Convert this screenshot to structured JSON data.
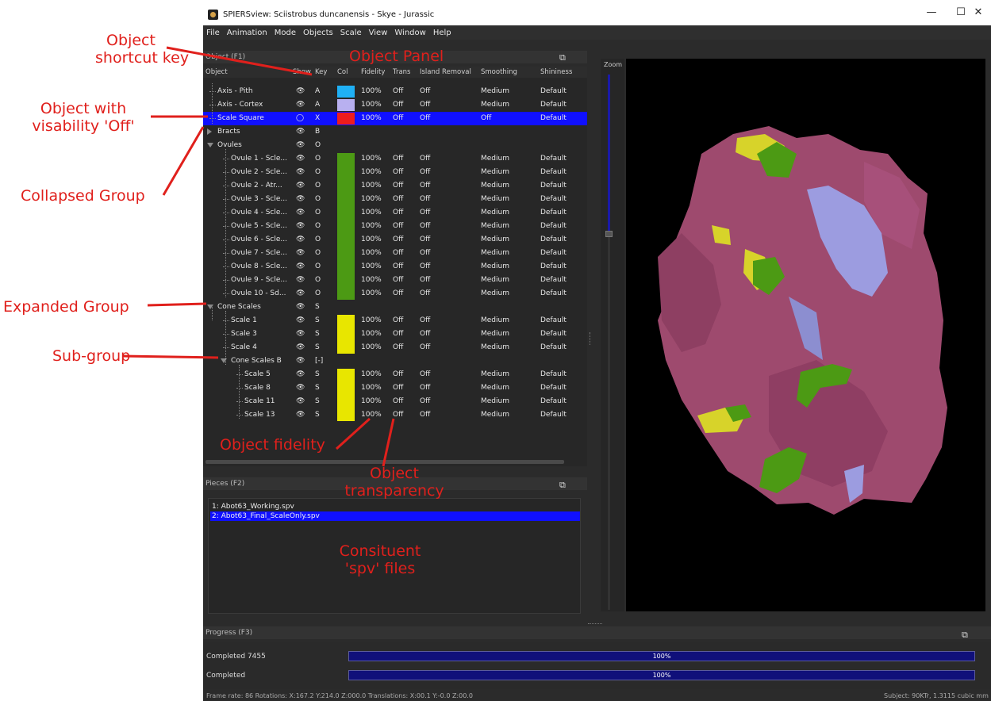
{
  "window": {
    "title": "SPIERSview: Sciistrobus duncanensis - Skye - Jurassic",
    "controls": [
      "—",
      "☐",
      "✕"
    ]
  },
  "menu": [
    "File",
    "Animation",
    "Mode",
    "Objects",
    "Scale",
    "View",
    "Window",
    "Help"
  ],
  "object_panel": {
    "title": "Object (F1)",
    "columns": {
      "object": "Object",
      "show": "Show",
      "key": "Key",
      "col": "Col",
      "fidelity": "Fidelity",
      "trans": "Trans",
      "island": "Island Removal",
      "smoothing": "Smoothing",
      "shininess": "Shininess"
    },
    "rows": [
      {
        "name": "Axis - Pith",
        "show": "👁",
        "key": "A",
        "fidelity": "100%",
        "trans": "Off",
        "island": "Off",
        "smoothing": "Medium",
        "shininess": "Default"
      },
      {
        "name": "Axis - Cortex",
        "show": "👁",
        "key": "A",
        "fidelity": "100%",
        "trans": "Off",
        "island": "Off",
        "smoothing": "Medium",
        "shininess": "Default"
      },
      {
        "name": "Scale Square",
        "show": "◯",
        "key": "X",
        "fidelity": "100%",
        "trans": "Off",
        "island": "Off",
        "smoothing": "Off",
        "shininess": "Default"
      },
      {
        "name": "Bracts",
        "show": "👁",
        "key": "B",
        "fidelity": "",
        "trans": "",
        "island": "",
        "smoothing": "",
        "shininess": ""
      },
      {
        "name": "Ovules",
        "show": "👁",
        "key": "O",
        "fidelity": "",
        "trans": "",
        "island": "",
        "smoothing": "",
        "shininess": ""
      },
      {
        "name": "Ovule 1 - Scle...",
        "show": "👁",
        "key": "O",
        "fidelity": "100%",
        "trans": "Off",
        "island": "Off",
        "smoothing": "Medium",
        "shininess": "Default"
      },
      {
        "name": "Ovule 2 - Scle...",
        "show": "👁",
        "key": "O",
        "fidelity": "100%",
        "trans": "Off",
        "island": "Off",
        "smoothing": "Medium",
        "shininess": "Default"
      },
      {
        "name": "Ovule 2 - Atr...",
        "show": "👁",
        "key": "O",
        "fidelity": "100%",
        "trans": "Off",
        "island": "Off",
        "smoothing": "Medium",
        "shininess": "Default"
      },
      {
        "name": "Ovule 3 - Scle...",
        "show": "👁",
        "key": "O",
        "fidelity": "100%",
        "trans": "Off",
        "island": "Off",
        "smoothing": "Medium",
        "shininess": "Default"
      },
      {
        "name": "Ovule 4 - Scle...",
        "show": "👁",
        "key": "O",
        "fidelity": "100%",
        "trans": "Off",
        "island": "Off",
        "smoothing": "Medium",
        "shininess": "Default"
      },
      {
        "name": "Ovule 5 - Scle...",
        "show": "👁",
        "key": "O",
        "fidelity": "100%",
        "trans": "Off",
        "island": "Off",
        "smoothing": "Medium",
        "shininess": "Default"
      },
      {
        "name": "Ovule 6 - Scle...",
        "show": "👁",
        "key": "O",
        "fidelity": "100%",
        "trans": "Off",
        "island": "Off",
        "smoothing": "Medium",
        "shininess": "Default"
      },
      {
        "name": "Ovule 7 - Scle...",
        "show": "👁",
        "key": "O",
        "fidelity": "100%",
        "trans": "Off",
        "island": "Off",
        "smoothing": "Medium",
        "shininess": "Default"
      },
      {
        "name": "Ovule 8 - Scle...",
        "show": "👁",
        "key": "O",
        "fidelity": "100%",
        "trans": "Off",
        "island": "Off",
        "smoothing": "Medium",
        "shininess": "Default"
      },
      {
        "name": "Ovule 9 - Scle...",
        "show": "👁",
        "key": "O",
        "fidelity": "100%",
        "trans": "Off",
        "island": "Off",
        "smoothing": "Medium",
        "shininess": "Default"
      },
      {
        "name": "Ovule 10 - Sd...",
        "show": "👁",
        "key": "O",
        "fidelity": "100%",
        "trans": "Off",
        "island": "Off",
        "smoothing": "Medium",
        "shininess": "Default"
      },
      {
        "name": "Cone Scales",
        "show": "👁",
        "key": "S",
        "fidelity": "",
        "trans": "",
        "island": "",
        "smoothing": "",
        "shininess": ""
      },
      {
        "name": "Scale 1",
        "show": "👁",
        "key": "S",
        "fidelity": "100%",
        "trans": "Off",
        "island": "Off",
        "smoothing": "Medium",
        "shininess": "Default"
      },
      {
        "name": "Scale 3",
        "show": "👁",
        "key": "S",
        "fidelity": "100%",
        "trans": "Off",
        "island": "Off",
        "smoothing": "Medium",
        "shininess": "Default"
      },
      {
        "name": "Scale 4",
        "show": "👁",
        "key": "S",
        "fidelity": "100%",
        "trans": "Off",
        "island": "Off",
        "smoothing": "Medium",
        "shininess": "Default"
      },
      {
        "name": "Cone Scales B",
        "show": "👁",
        "key": "[-]",
        "fidelity": "",
        "trans": "",
        "island": "",
        "smoothing": "",
        "shininess": ""
      },
      {
        "name": "Scale 5",
        "show": "👁",
        "key": "S",
        "fidelity": "100%",
        "trans": "Off",
        "island": "Off",
        "smoothing": "Medium",
        "shininess": "Default"
      },
      {
        "name": "Scale 8",
        "show": "👁",
        "key": "S",
        "fidelity": "100%",
        "trans": "Off",
        "island": "Off",
        "smoothing": "Medium",
        "shininess": "Default"
      },
      {
        "name": "Scale 11",
        "show": "👁",
        "key": "S",
        "fidelity": "100%",
        "trans": "Off",
        "island": "Off",
        "smoothing": "Medium",
        "shininess": "Default"
      },
      {
        "name": "Scale 13",
        "show": "👁",
        "key": "S",
        "fidelity": "100%",
        "trans": "Off",
        "island": "Off",
        "smoothing": "Medium",
        "shininess": "Default"
      }
    ],
    "colors": {
      "pith": "#1fb0f5",
      "cortex": "#b8b0f0",
      "scale_square": "#ee1c1c",
      "ovules": "#4c9a14",
      "scales": "#e8e600"
    }
  },
  "pieces_panel": {
    "title": "Pieces (F2)",
    "items": [
      "1: Abot63_Working.spv",
      "2: Abot63_Final_ScaleOnly.spv"
    ]
  },
  "zoom": {
    "label": "Zoom"
  },
  "progress_panel": {
    "title": "Progress (F3)",
    "rows": [
      {
        "label": "Completed 7455",
        "percent": "100%"
      },
      {
        "label": "Completed",
        "percent": "100%"
      }
    ]
  },
  "statusbar": {
    "left": "Frame rate: 86  Rotations: X:167.2 Y:214.0 Z:000.0  Translations: X:00.1 Y:-0.0 Z:00.0",
    "right": "Subject: 90KTr, 1.3115 cubic mm"
  },
  "annotations": {
    "object_shortcut_key": [
      "Object",
      "shortcut key"
    ],
    "object_panel": "Object Panel",
    "object_visibility_off": [
      "Object with",
      "visability 'Off'"
    ],
    "collapsed_group": "Collapsed Group",
    "expanded_group": "Expanded Group",
    "sub_group": "Sub-group",
    "object_fidelity": "Object fidelity",
    "object_transparency": [
      "Object",
      "transparency"
    ],
    "constituent_files": [
      "Consituent",
      "'spv' files"
    ]
  },
  "model_colors": {
    "bracts": "#9e4a6e",
    "ovule": "#4c9a14",
    "scale": "#d7d32a",
    "axis": "#9c9ce0"
  }
}
